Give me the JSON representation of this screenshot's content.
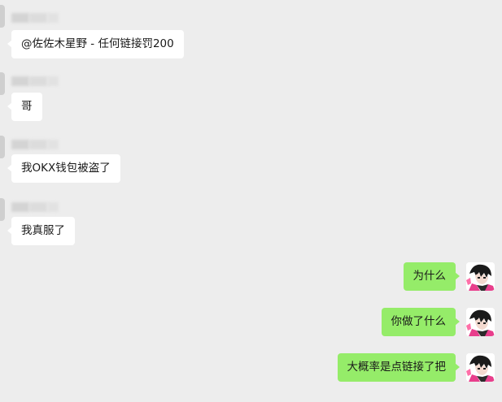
{
  "messages": [
    {
      "direction": "incoming",
      "text": "@佐佐木星野 - 任何链接罚200"
    },
    {
      "direction": "incoming",
      "text": "哥"
    },
    {
      "direction": "incoming",
      "text": "我OKX钱包被盗了"
    },
    {
      "direction": "incoming",
      "text": "我真服了"
    },
    {
      "direction": "outgoing",
      "text": "为什么"
    },
    {
      "direction": "outgoing",
      "text": "你做了什么"
    },
    {
      "direction": "outgoing",
      "text": "大概率是点链接了把"
    }
  ],
  "colors": {
    "background": "#ededed",
    "incoming_bubble": "#ffffff",
    "outgoing_bubble": "#95ec69",
    "text": "#191919"
  },
  "icons": {
    "incoming_avatar": "blurred-avatar-icon",
    "sender_name": "blurred-name",
    "outgoing_avatar": "anime-avatar-icon"
  }
}
